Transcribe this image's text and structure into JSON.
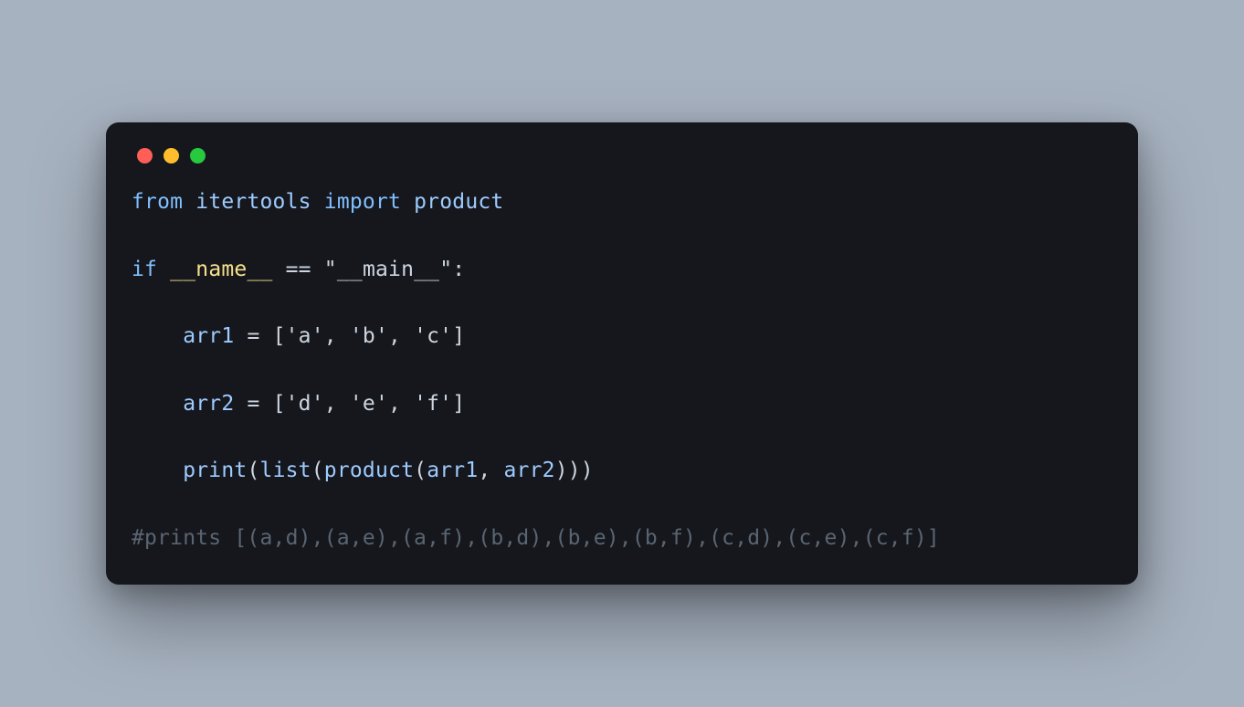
{
  "traffic_lights": [
    "red",
    "yellow",
    "green"
  ],
  "code": {
    "line1": {
      "from": "from",
      "mod": "itertools",
      "import": "import",
      "name": "product"
    },
    "line2": {
      "if": "if",
      "dunder": "__name__",
      "eq": "==",
      "main": "\"__main__\"",
      "colon": ":"
    },
    "line3": {
      "indent": "    ",
      "var": "arr1",
      "assign": " = ",
      "val": "['a', 'b', 'c']"
    },
    "line4": {
      "indent": "    ",
      "var": "arr2",
      "assign": " = ",
      "val": "['d', 'e', 'f']"
    },
    "line5": {
      "indent": "    ",
      "print": "print",
      "op1": "(",
      "list": "list",
      "op2": "(",
      "product": "product",
      "op3": "(",
      "a1": "arr1",
      "comma": ", ",
      "a2": "arr2",
      "close": ")))"
    },
    "line6": {
      "text": "#prints [(a,d),(a,e),(a,f),(b,d),(b,e),(b,f),(c,d),(c,e),(c,f)]"
    }
  }
}
